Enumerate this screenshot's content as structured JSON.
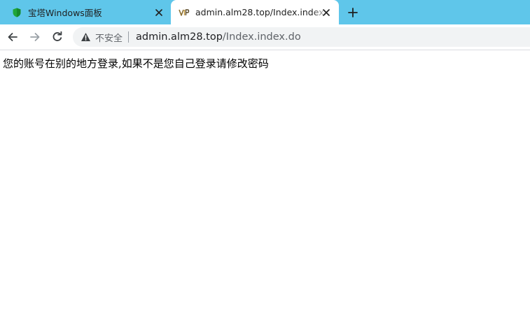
{
  "tabs": [
    {
      "title": "宝塔Windows面板",
      "favicon": "shield-icon",
      "favicon_color": "#20a53a",
      "active": false
    },
    {
      "title": "admin.alm28.top/Index.index.do",
      "favicon": "vip-logo-icon",
      "active": true
    }
  ],
  "toolbar": {
    "back": "arrow-left-icon",
    "forward": "arrow-right-icon",
    "reload": "reload-icon",
    "security_label": "不安全",
    "url_host": "admin.alm28.top",
    "url_path": "/Index.index.do"
  },
  "page": {
    "message": "您的账号在别的地方登录,如果不是您自己登录请修改密码"
  },
  "colors": {
    "tabstrip": "#5fc6ea",
    "omnibox": "#f1f3f4"
  }
}
